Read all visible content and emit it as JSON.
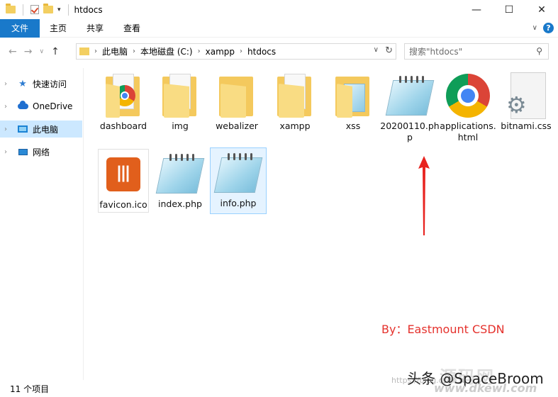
{
  "window": {
    "title": "htdocs",
    "controls": {
      "minimize": "—",
      "maximize": "☐",
      "close": "✕"
    }
  },
  "ribbon": {
    "tabs": [
      "文件",
      "主页",
      "共享",
      "查看"
    ]
  },
  "address": {
    "crumbs": [
      "此电脑",
      "本地磁盘 (C:)",
      "xampp",
      "htdocs"
    ]
  },
  "search": {
    "placeholder": "搜索\"htdocs\""
  },
  "nav_pane": {
    "items": [
      {
        "label": "快速访问",
        "icon": "star-icon"
      },
      {
        "label": "OneDrive",
        "icon": "cloud-icon"
      },
      {
        "label": "此电脑",
        "icon": "pc-icon",
        "selected": true
      },
      {
        "label": "网络",
        "icon": "network-icon"
      }
    ]
  },
  "files": [
    {
      "name": "dashboard",
      "type": "folder-chrome"
    },
    {
      "name": "img",
      "type": "folder"
    },
    {
      "name": "webalizer",
      "type": "folder-empty"
    },
    {
      "name": "xampp",
      "type": "folder"
    },
    {
      "name": "xss",
      "type": "folder-notepad"
    },
    {
      "name": "20200110.php",
      "type": "notepad"
    },
    {
      "name": "applications.html",
      "type": "chrome"
    },
    {
      "name": "bitnami.css",
      "type": "css"
    },
    {
      "name": "favicon.ico",
      "type": "xampp"
    },
    {
      "name": "index.php",
      "type": "notepad"
    },
    {
      "name": "info.php",
      "type": "notepad",
      "selected": true
    }
  ],
  "annotation": {
    "text": "By：Eastmount CSDN",
    "color": "#e5322d"
  },
  "status": {
    "count": "11 个项目"
  },
  "watermark": {
    "author": "头条 @SpaceBroom",
    "site_small": "https://blog.csdn.n",
    "site_big": "源码网",
    "site_url": "www.dkewl.com"
  }
}
